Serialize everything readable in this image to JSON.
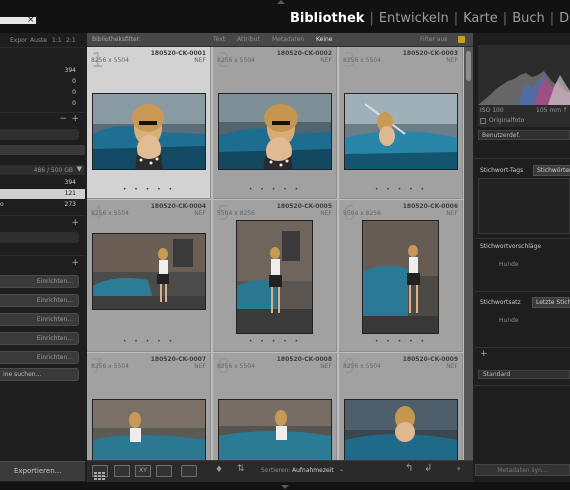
{
  "modules": {
    "items": [
      "Bibliothek",
      "Entwickeln",
      "Karte",
      "Buch",
      "Diashow"
    ],
    "active": "Bibliothek"
  },
  "left_panel": {
    "header_labels": [
      "Expor",
      "Auste",
      "1:1",
      "2:1"
    ],
    "catalog_counts": [
      "394",
      "0",
      "0",
      "0"
    ],
    "folder_volume": "486 / 500 GB",
    "folders": [
      {
        "label": "",
        "count": "394"
      },
      {
        "label": "",
        "count": "121"
      },
      {
        "label": "o",
        "count": "273"
      }
    ],
    "publish_buttons": [
      "Einrichten...",
      "Einrichten...",
      "Einrichten...",
      "Einrichten...",
      "Einrichten..."
    ],
    "find_more": "ine suchen...",
    "export_button": "Exportieren..."
  },
  "filter_bar": {
    "title": "Bibliotheksfilter:",
    "options": [
      "Text",
      "Attribut",
      "Metadaten",
      "Keine"
    ],
    "active": "Keine",
    "filter_state": "Filter aus"
  },
  "grid": [
    {
      "index": "1",
      "filename": "180520-CK-0001",
      "dims": "8256 x 5504",
      "ext": "NEF",
      "selected": true,
      "dots": "• • • • •"
    },
    {
      "index": "2",
      "filename": "180520-CK-0002",
      "dims": "8256 x 5504",
      "ext": "NEF",
      "selected": false,
      "dots": "• • • • •"
    },
    {
      "index": "3",
      "filename": "180520-CK-0003",
      "dims": "8256 x 5504",
      "ext": "NEF",
      "selected": false,
      "dots": "• • • • •"
    },
    {
      "index": "4",
      "filename": "180520-CK-0004",
      "dims": "8256 x 5504",
      "ext": "NEF",
      "selected": false,
      "dots": "• • • • •"
    },
    {
      "index": "5",
      "filename": "180520-CK-0005",
      "dims": "5504 x 8256",
      "ext": "NEF",
      "selected": false,
      "dots": "• • • • •"
    },
    {
      "index": "6",
      "filename": "180520-CK-0006",
      "dims": "5504 x 8256",
      "ext": "NEF",
      "selected": false,
      "dots": "• • • • •"
    },
    {
      "index": "7",
      "filename": "180520-CK-0007",
      "dims": "8256 x 5504",
      "ext": "NEF",
      "selected": false,
      "dots": ""
    },
    {
      "index": "8",
      "filename": "180520-CK-0008",
      "dims": "8256 x 5504",
      "ext": "NEF",
      "selected": false,
      "dots": ""
    },
    {
      "index": "9",
      "filename": "180520-CK-0009",
      "dims": "8256 x 5504",
      "ext": "NEF",
      "selected": false,
      "dots": ""
    }
  ],
  "right_panel": {
    "histogram_iso": "ISO 100",
    "histogram_focal": "105 mm",
    "histogram_aperture": "f",
    "original_photo": "Originalfoto",
    "preset_select": "Benutzerdef.",
    "keyword_tags_label": "Stichwort-Tags",
    "keyword_tags_tab": "Stichwörter",
    "suggestions_label": "Stichwortvorschläge",
    "suggestions_value": "Hunde",
    "set_label": "Stichwortsatz",
    "set_tab": "Letzte Stich",
    "set_value": "Hunde",
    "standard_select": "Standard"
  },
  "toolbar": {
    "sort_label": "Sortieren:",
    "sort_value": "Aufnahmezeit",
    "metadata_sync": "Metadaten syn..."
  },
  "colors": {
    "background": "#1f1f1f",
    "grid_bg": "#bdbdbd",
    "accent": "#ffffff"
  }
}
